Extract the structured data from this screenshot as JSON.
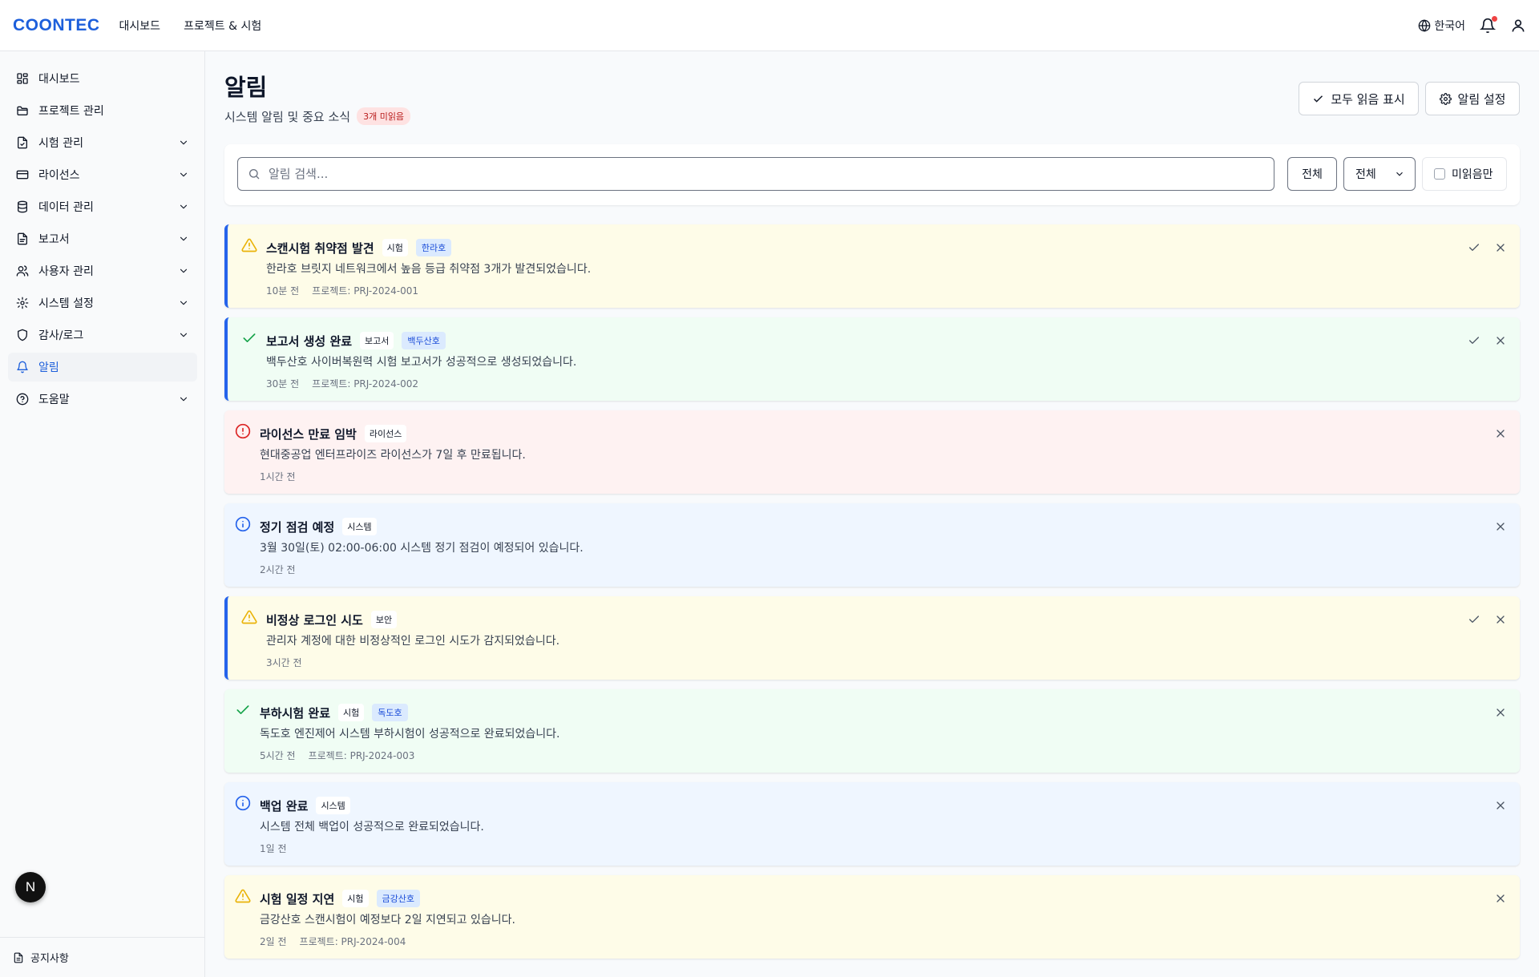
{
  "header": {
    "logo": "COONTEC",
    "nav": [
      "대시보드",
      "프로젝트 & 시험"
    ],
    "language": "한국어"
  },
  "sidebar": {
    "items": [
      {
        "label": "대시보드",
        "icon": "dashboard-grid-icon",
        "expandable": false
      },
      {
        "label": "프로젝트 관리",
        "icon": "folder-icon",
        "expandable": false
      },
      {
        "label": "시험 관리",
        "icon": "test-file-icon",
        "expandable": true
      },
      {
        "label": "라이선스",
        "icon": "credit-card-icon",
        "expandable": true
      },
      {
        "label": "데이터 관리",
        "icon": "database-icon",
        "expandable": true
      },
      {
        "label": "보고서",
        "icon": "report-file-icon",
        "expandable": true
      },
      {
        "label": "사용자 관리",
        "icon": "users-icon",
        "expandable": true
      },
      {
        "label": "시스템 설정",
        "icon": "gear-icon",
        "expandable": true
      },
      {
        "label": "감사/로그",
        "icon": "shield-icon",
        "expandable": true
      },
      {
        "label": "알림",
        "icon": "bell-icon",
        "expandable": false,
        "active": true
      },
      {
        "label": "도움말",
        "icon": "help-circle-icon",
        "expandable": true
      }
    ],
    "bottom_label": "공지사항",
    "floating_badge": "N"
  },
  "page": {
    "title": "알림",
    "subtitle": "시스템 알림 및 중요 소식",
    "unread_badge": "3개 미읽음",
    "mark_all_read": "모두 읽음 표시",
    "settings": "알림 설정"
  },
  "filters": {
    "search_placeholder": "알림 검색...",
    "type_filter": "전체",
    "category_filter": "전체",
    "unread_only": "미읽음만"
  },
  "colors": {
    "brand": "#1d5fdb",
    "unread_accent": "#2563eb",
    "warning": "#eab308",
    "success": "#16a34a",
    "error": "#dc2626",
    "info": "#2563eb"
  },
  "notifications": [
    {
      "type": "warning",
      "unread": true,
      "title": "스캔시험 취약점 발견",
      "category": "시험",
      "ship": "한라호",
      "message": "한라호 브릿지 네트워크에서 높음 등급 취약점 3개가 발견되었습니다.",
      "time": "10분 전",
      "project": "프로젝트: PRJ-2024-001"
    },
    {
      "type": "success",
      "unread": true,
      "title": "보고서 생성 완료",
      "category": "보고서",
      "ship": "백두산호",
      "message": "백두산호 사이버복원력 시험 보고서가 성공적으로 생성되었습니다.",
      "time": "30분 전",
      "project": "프로젝트: PRJ-2024-002"
    },
    {
      "type": "error",
      "unread": false,
      "title": "라이선스 만료 임박",
      "category": "라이선스",
      "ship": "",
      "message": "현대중공업 엔터프라이즈 라이선스가 7일 후 만료됩니다.",
      "time": "1시간 전",
      "project": ""
    },
    {
      "type": "info",
      "unread": false,
      "title": "정기 점검 예정",
      "category": "시스템",
      "ship": "",
      "message": "3월 30일(토) 02:00-06:00 시스템 정기 점검이 예정되어 있습니다.",
      "time": "2시간 전",
      "project": ""
    },
    {
      "type": "warning",
      "unread": true,
      "title": "비정상 로그인 시도",
      "category": "보안",
      "ship": "",
      "message": "관리자 계정에 대한 비정상적인 로그인 시도가 감지되었습니다.",
      "time": "3시간 전",
      "project": ""
    },
    {
      "type": "success",
      "unread": false,
      "title": "부하시험 완료",
      "category": "시험",
      "ship": "독도호",
      "message": "독도호 엔진제어 시스템 부하시험이 성공적으로 완료되었습니다.",
      "time": "5시간 전",
      "project": "프로젝트: PRJ-2024-003"
    },
    {
      "type": "info",
      "unread": false,
      "title": "백업 완료",
      "category": "시스템",
      "ship": "",
      "message": "시스템 전체 백업이 성공적으로 완료되었습니다.",
      "time": "1일 전",
      "project": ""
    },
    {
      "type": "warning",
      "unread": false,
      "title": "시험 일정 지연",
      "category": "시험",
      "ship": "금강산호",
      "message": "금강산호 스캔시험이 예정보다 2일 지연되고 있습니다.",
      "time": "2일 전",
      "project": "프로젝트: PRJ-2024-004"
    }
  ]
}
